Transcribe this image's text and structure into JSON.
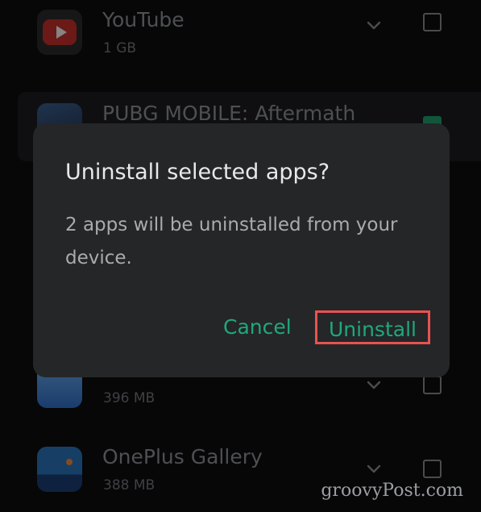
{
  "apps": [
    {
      "name": "YouTube",
      "size": "1 GB",
      "checked": false,
      "icon": "youtube-icon"
    },
    {
      "name": "PUBG MOBILE: Aftermath",
      "size": "",
      "checked": true,
      "icon": "pubg-icon"
    },
    {
      "name": "",
      "size": "396 MB",
      "checked": false,
      "icon": "weather-icon"
    },
    {
      "name": "OnePlus Gallery",
      "size": "388 MB",
      "checked": false,
      "icon": "gallery-icon"
    }
  ],
  "dialog": {
    "title": "Uninstall selected apps?",
    "message": "2 apps will be uninstalled from your device.",
    "cancel_label": "Cancel",
    "uninstall_label": "Uninstall"
  },
  "colors": {
    "accent": "#1fa978",
    "highlight": "#e8534f",
    "dialog_bg": "#252628",
    "page_bg": "#0d0d0f"
  },
  "watermark": "groovyPost.com"
}
